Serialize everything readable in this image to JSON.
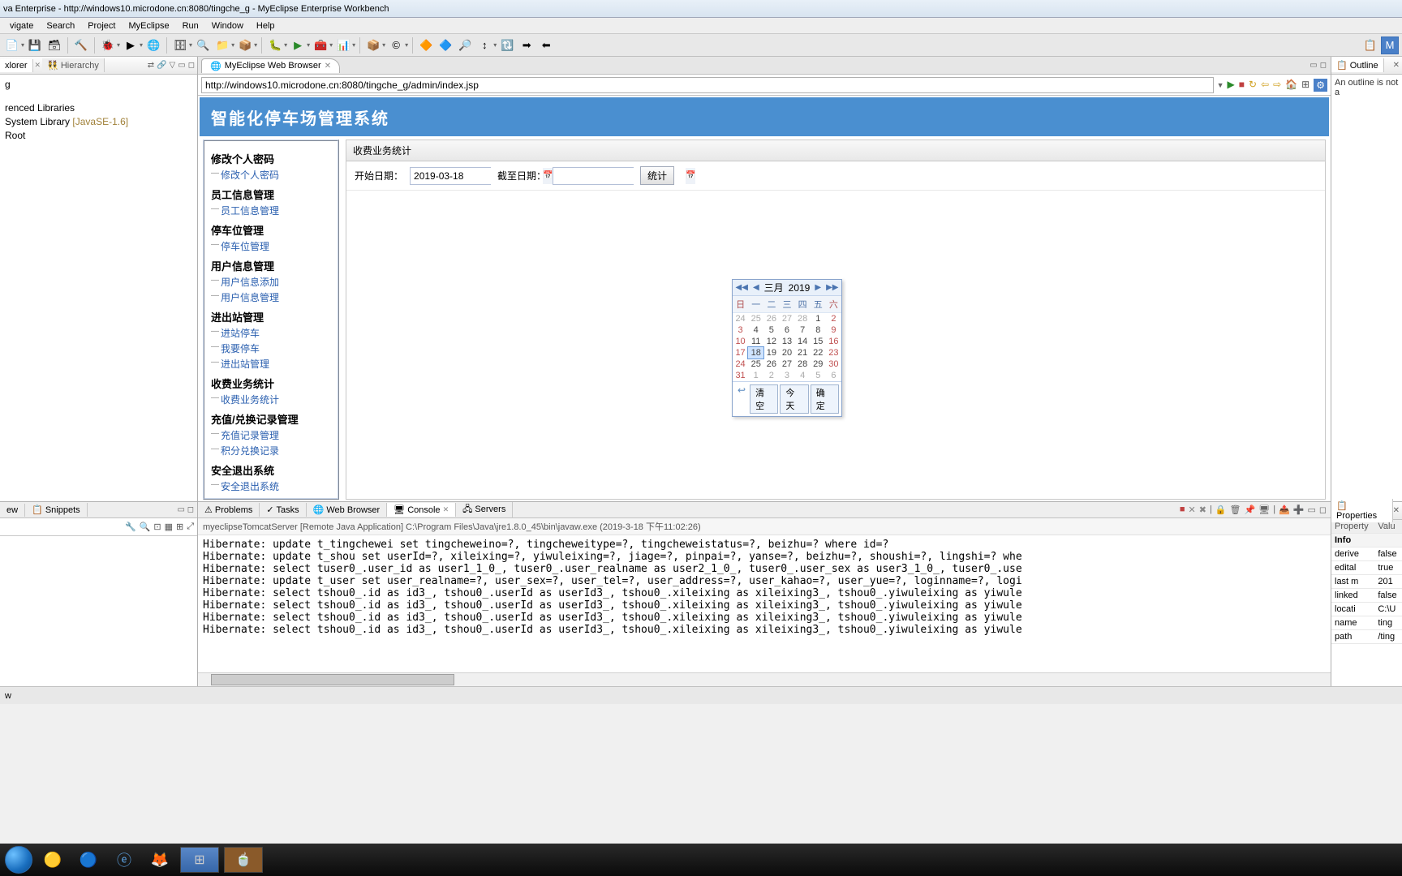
{
  "titlebar": "va Enterprise - http://windows10.microdone.cn:8080/tingche_g - MyEclipse Enterprise Workbench",
  "menus": [
    "vigate",
    "Search",
    "Project",
    "MyEclipse",
    "Run",
    "Window",
    "Help"
  ],
  "pkg_tabs": [
    "xlorer",
    "Hierarchy"
  ],
  "tree": {
    "root": "g",
    "items": [
      "renced Libraries",
      "System Library",
      "JavaSE-1.6",
      "Root"
    ]
  },
  "editor_tab": "MyEclipse Web Browser",
  "url": "http://windows10.microdone.cn:8080/tingche_g/admin/index.jsp",
  "app": {
    "header": "智能化停车场管理系统",
    "side": [
      {
        "g": "修改个人密码",
        "links": [
          "修改个人密码"
        ]
      },
      {
        "g": "员工信息管理",
        "links": [
          "员工信息管理"
        ]
      },
      {
        "g": "停车位管理",
        "links": [
          "停车位管理"
        ]
      },
      {
        "g": "用户信息管理",
        "links": [
          "用户信息添加",
          "用户信息管理"
        ]
      },
      {
        "g": "进出站管理",
        "links": [
          "进站停车",
          "我要停车",
          "进出站管理"
        ]
      },
      {
        "g": "收费业务统计",
        "links": [
          "收费业务统计"
        ]
      },
      {
        "g": "充值/兑换记录管理",
        "links": [
          "充值记录管理",
          "积分兑换记录"
        ]
      },
      {
        "g": "安全退出系统",
        "links": [
          "安全退出系统"
        ]
      }
    ],
    "panel_title": "收费业务统计",
    "start_label": "开始日期：",
    "end_label": "截至日期：",
    "start_value": "2019-03-18",
    "end_value": "",
    "stat_btn": "统计"
  },
  "cal": {
    "month": "三月",
    "year": "2019",
    "dow": [
      "日",
      "一",
      "二",
      "三",
      "四",
      "五",
      "六"
    ],
    "rows": [
      [
        {
          "v": 24,
          "o": 1
        },
        {
          "v": 25,
          "o": 1
        },
        {
          "v": 26,
          "o": 1
        },
        {
          "v": 27,
          "o": 1
        },
        {
          "v": 28,
          "o": 1
        },
        {
          "v": 1
        },
        {
          "v": 2,
          "we": 1
        }
      ],
      [
        {
          "v": 3,
          "we": 1
        },
        {
          "v": 4
        },
        {
          "v": 5
        },
        {
          "v": 6
        },
        {
          "v": 7
        },
        {
          "v": 8
        },
        {
          "v": 9,
          "we": 1
        }
      ],
      [
        {
          "v": 10,
          "we": 1
        },
        {
          "v": 11
        },
        {
          "v": 12
        },
        {
          "v": 13
        },
        {
          "v": 14
        },
        {
          "v": 15
        },
        {
          "v": 16,
          "we": 1
        }
      ],
      [
        {
          "v": 17,
          "we": 1
        },
        {
          "v": 18,
          "sel": 1
        },
        {
          "v": 19
        },
        {
          "v": 20
        },
        {
          "v": 21
        },
        {
          "v": 22
        },
        {
          "v": 23,
          "we": 1
        }
      ],
      [
        {
          "v": 24,
          "we": 1
        },
        {
          "v": 25
        },
        {
          "v": 26
        },
        {
          "v": 27
        },
        {
          "v": 28
        },
        {
          "v": 29
        },
        {
          "v": 30,
          "we": 1
        }
      ],
      [
        {
          "v": 31,
          "we": 1
        },
        {
          "v": 1,
          "o": 1
        },
        {
          "v": 2,
          "o": 1
        },
        {
          "v": 3,
          "o": 1
        },
        {
          "v": 4,
          "o": 1
        },
        {
          "v": 5,
          "o": 1
        },
        {
          "v": 6,
          "o": 1
        }
      ]
    ],
    "clear": "清空",
    "today": "今天",
    "ok": "确定"
  },
  "outline_tab": "Outline",
  "outline_text": "An outline is not a",
  "snip_tabs": [
    "ew",
    "Snippets"
  ],
  "bottom_tabs": [
    "Problems",
    "Tasks",
    "Web Browser",
    "Console",
    "Servers"
  ],
  "console_head": "myeclipseTomcatServer [Remote Java Application] C:\\Program Files\\Java\\jre1.8.0_45\\bin\\javaw.exe (2019-3-18 下午11:02:26)",
  "console_lines": [
    "Hibernate: update t_tingchewei set tingcheweino=?, tingcheweitype=?, tingcheweistatus=?, beizhu=? where id=?",
    "Hibernate: update t_shou set userId=?, xileixing=?, yiwuleixing=?, jiage=?, pinpai=?, yanse=?, beizhu=?, shoushi=?, lingshi=? whe",
    "Hibernate: select tuser0_.user_id as user1_1_0_, tuser0_.user_realname as user2_1_0_, tuser0_.user_sex as user3_1_0_, tuser0_.use",
    "Hibernate: update t_user set user_realname=?, user_sex=?, user_tel=?, user_address=?, user_kahao=?, user_yue=?, loginname=?, logi",
    "Hibernate: select tshou0_.id as id3_, tshou0_.userId as userId3_, tshou0_.xileixing as xileixing3_, tshou0_.yiwuleixing as yiwule",
    "Hibernate: select tshou0_.id as id3_, tshou0_.userId as userId3_, tshou0_.xileixing as xileixing3_, tshou0_.yiwuleixing as yiwule",
    "Hibernate: select tshou0_.id as id3_, tshou0_.userId as userId3_, tshou0_.xileixing as xileixing3_, tshou0_.yiwuleixing as yiwule",
    "Hibernate: select tshou0_.id as id3_, tshou0_.userId as userId3_, tshou0_.xileixing as xileixing3_, tshou0_.yiwuleixing as yiwule"
  ],
  "props_tab": "Properties",
  "props_hdr": [
    "Property",
    "Valu"
  ],
  "props_grp": "Info",
  "props": [
    [
      "derive",
      "false"
    ],
    [
      "edital",
      "true"
    ],
    [
      "last m",
      "201"
    ],
    [
      "linked",
      "false"
    ],
    [
      "locati",
      "C:\\U"
    ],
    [
      "name",
      "ting"
    ],
    [
      "path",
      "/ting"
    ]
  ],
  "status": "w"
}
